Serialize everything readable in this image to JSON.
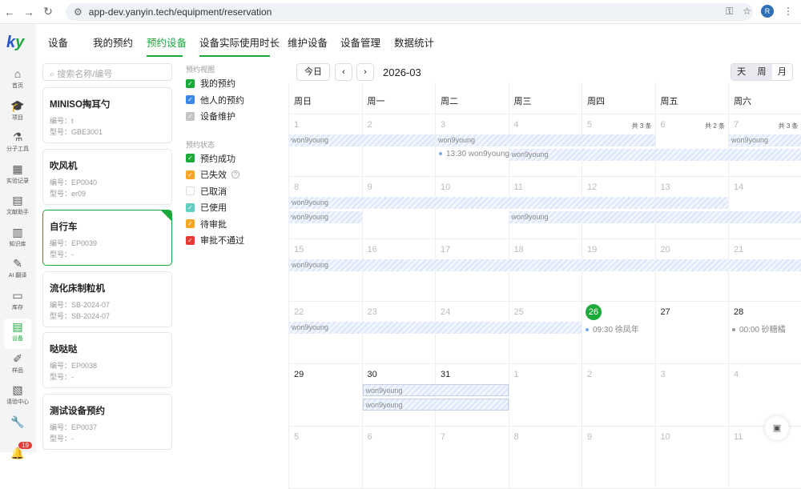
{
  "browser": {
    "url": "app-dev.yanyin.tech/equipment/reservation",
    "avatar": "R"
  },
  "nav": [
    {
      "label": "首页",
      "icon": "⌂"
    },
    {
      "label": "项目",
      "icon": "🎓"
    },
    {
      "label": "分子工具",
      "icon": "⚗"
    },
    {
      "label": "实验记录",
      "icon": "▦"
    },
    {
      "label": "文献助手",
      "icon": "▤"
    },
    {
      "label": "知识库",
      "icon": "▥"
    },
    {
      "label": "AI 翻译",
      "icon": "✎"
    },
    {
      "label": "库存",
      "icon": "▭"
    },
    {
      "label": "设备",
      "icon": "▤",
      "active": true
    },
    {
      "label": "样品",
      "icon": "✐"
    },
    {
      "label": "请验中心",
      "icon": "▧"
    },
    {
      "label": "",
      "icon": "🔧"
    },
    {
      "label": "",
      "icon": "🔔",
      "badge": "19"
    }
  ],
  "tabs": [
    "设备",
    "我的预约",
    "预约设备",
    "设备实际使用时长",
    "维护设备",
    "设备管理",
    "数据统计"
  ],
  "search_placeholder": "搜索名称/编号",
  "devices": [
    {
      "name": "MINISO掏耳勺",
      "code": "编号：t",
      "model": "型号：GBE3001"
    },
    {
      "name": "吹风机",
      "code": "编号：EP0040",
      "model": "型号：er09"
    },
    {
      "name": "自行车",
      "code": "编号：EP0039",
      "model": "型号：-",
      "selected": true
    },
    {
      "name": "流化床制粒机",
      "code": "编号：SB-2024-07",
      "model": "型号：SB-2024-07"
    },
    {
      "name": "哒哒哒",
      "code": "编号：EP0038",
      "model": "型号：-"
    },
    {
      "name": "测试设备预约",
      "code": "编号：EP0037",
      "model": "型号：-"
    }
  ],
  "filters": {
    "view_title": "预约视图",
    "views": [
      {
        "label": "我的预约",
        "color": "#1aaa3a",
        "checked": true
      },
      {
        "label": "他人的预约",
        "color": "#3a86e8",
        "checked": true
      },
      {
        "label": "设备维护",
        "color": "#c4c4c4",
        "checked": true
      }
    ],
    "status_title": "预约状态",
    "statuses": [
      {
        "label": "预约成功",
        "color": "#1aaa3a",
        "checked": true
      },
      {
        "label": "已失效",
        "color": "#f5a623",
        "checked": true,
        "help": "?"
      },
      {
        "label": "已取消",
        "color": "#ffffff",
        "checked": false
      },
      {
        "label": "已使用",
        "color": "#5fd0c0",
        "checked": true
      },
      {
        "label": "待审批",
        "color": "#f5a623",
        "checked": true
      },
      {
        "label": "审批不通过",
        "color": "#e53935",
        "checked": true
      }
    ]
  },
  "toolbar": {
    "today": "今日",
    "prev": "‹",
    "next": "›",
    "month": "2026-03",
    "views": [
      "天",
      "周",
      "月"
    ],
    "active_view": "月"
  },
  "calendar": {
    "weekdays": [
      "周日",
      "周一",
      "周二",
      "周三",
      "周四",
      "周五",
      "周六"
    ],
    "weeks": [
      [
        {
          "d": "1"
        },
        {
          "d": "2"
        },
        {
          "d": "3"
        },
        {
          "d": "4"
        },
        {
          "d": "5",
          "more": "共 3 条"
        },
        {
          "d": "6",
          "more": "共 2 条"
        },
        {
          "d": "7",
          "more": "共 3 条"
        }
      ],
      [
        {
          "d": "8"
        },
        {
          "d": "9"
        },
        {
          "d": "10"
        },
        {
          "d": "11"
        },
        {
          "d": "12"
        },
        {
          "d": "13"
        },
        {
          "d": "14"
        }
      ],
      [
        {
          "d": "15"
        },
        {
          "d": "16"
        },
        {
          "d": "17"
        },
        {
          "d": "18"
        },
        {
          "d": "19"
        },
        {
          "d": "20"
        },
        {
          "d": "21"
        }
      ],
      [
        {
          "d": "22"
        },
        {
          "d": "23"
        },
        {
          "d": "24"
        },
        {
          "d": "25"
        },
        {
          "d": "26",
          "today": true
        },
        {
          "d": "27",
          "cur": true
        },
        {
          "d": "28",
          "cur": true
        }
      ],
      [
        {
          "d": "29",
          "cur": true
        },
        {
          "d": "30",
          "cur": true
        },
        {
          "d": "31",
          "cur": true
        },
        {
          "d": "1"
        },
        {
          "d": "2"
        },
        {
          "d": "3"
        },
        {
          "d": "4"
        }
      ],
      [
        {
          "d": "5"
        },
        {
          "d": "6"
        },
        {
          "d": "7"
        },
        {
          "d": "8"
        },
        {
          "d": "9"
        },
        {
          "d": "10"
        },
        {
          "d": "11"
        }
      ]
    ],
    "bars": [
      {
        "week": 0,
        "from": 0,
        "to": 1,
        "lane": 0,
        "label": "won9young"
      },
      {
        "week": 0,
        "from": 2,
        "to": 4,
        "lane": 0,
        "label": "won9young"
      },
      {
        "week": 0,
        "from": 6,
        "to": 6,
        "lane": 0,
        "label": "won9young"
      },
      {
        "week": 0,
        "from": 3,
        "to": 6,
        "lane": 1,
        "label": "won9young"
      },
      {
        "week": 1,
        "from": 0,
        "to": 5,
        "lane": 0,
        "label": "won9young"
      },
      {
        "week": 1,
        "from": 0,
        "to": 0,
        "lane": 1,
        "label": "won9young"
      },
      {
        "week": 1,
        "from": 3,
        "to": 6,
        "lane": 1,
        "label": "won9young"
      },
      {
        "week": 2,
        "from": 0,
        "to": 6,
        "lane": 0,
        "label": "won9young"
      },
      {
        "week": 3,
        "from": 0,
        "to": 3,
        "lane": 0,
        "label": "won9young"
      },
      {
        "week": 4,
        "from": 1,
        "to": 2,
        "lane": 0,
        "label": "won9young",
        "bordered": true
      },
      {
        "week": 4,
        "from": 1,
        "to": 2,
        "lane": 1,
        "label": "won9young",
        "bordered": true
      }
    ],
    "dots": [
      {
        "week": 0,
        "col": 2,
        "lane": 1,
        "label": "13:30 won9young"
      },
      {
        "week": 3,
        "col": 4,
        "lane": 0,
        "label": "09:30 徐凤年"
      },
      {
        "week": 3,
        "col": 6,
        "lane": 0,
        "label": "00:00 砂糖橘",
        "grey": true
      }
    ]
  },
  "fab_icon": "chat"
}
